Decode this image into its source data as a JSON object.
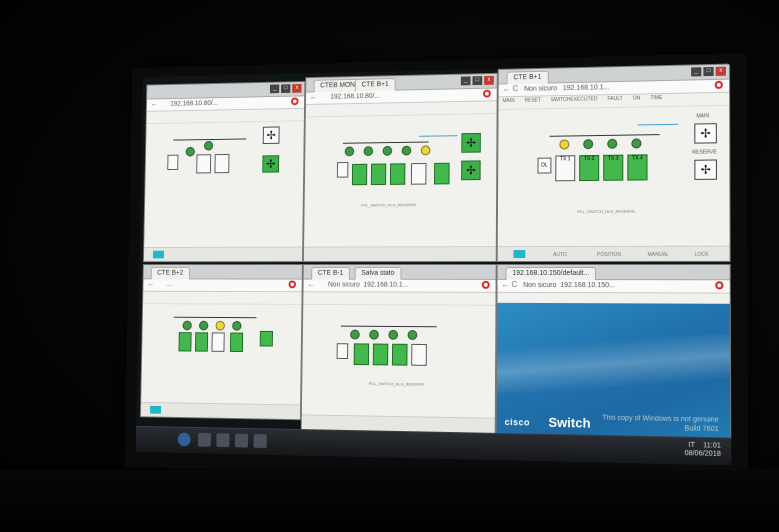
{
  "windows": {
    "top_left": {
      "title": "...",
      "url": "192.168.10.80/..."
    },
    "top_mid": {
      "tab1": "CTEB MON",
      "tab2": "CTE B+1",
      "url": "192.168.10.80/...",
      "diagram_caption": "PCL_SWITCH_DLG_RESERVE"
    },
    "top_right": {
      "tab": "CTE B+1",
      "not_secure": "Non sicuro",
      "url": "192.168.10.1...",
      "status": [
        "MAIN",
        "RESET",
        "SWITCHEXECUTED",
        "FAULT",
        "ON",
        "TIME"
      ],
      "labels": {
        "dl": "DL",
        "tx1": "TX 1",
        "tx2": "TX 2",
        "tx3": "TX 3",
        "tx4": "TX 4",
        "main": "MAIN",
        "reserve": "RESERVE"
      },
      "caption": "PCL_SWITCH_DLG_RESERVE",
      "bottom": [
        "AUTO",
        "POSITION",
        "MANUAL",
        "LOCK"
      ]
    },
    "bottom_left": {
      "tab": "CTE B+2",
      "url": "..."
    },
    "bottom_mid": {
      "tab1": "CTE B-1",
      "tab2": "Salva stato",
      "not_secure": "Non sicuro",
      "url": "192.168.10.1...",
      "caption": "PCL_SWITCH_DLG_RESERVE"
    },
    "bottom_right": {
      "tab": "192.168.10.150/default...",
      "not_secure": "Non sicuro",
      "url": "192.168.10.150...",
      "cisco_logo": "cisco",
      "switch_text": "Switch"
    }
  },
  "taskbar": {
    "lang": "IT",
    "time": "11:01",
    "date": "08/06/2018"
  },
  "watermark": {
    "line1": "This copy of Windows is not genuine",
    "line2": "Build 7601"
  },
  "colors": {
    "green": "#3fba48",
    "yellow": "#f0d43a",
    "cisco_blue": "#1d74b2",
    "opera_red": "#d22"
  }
}
